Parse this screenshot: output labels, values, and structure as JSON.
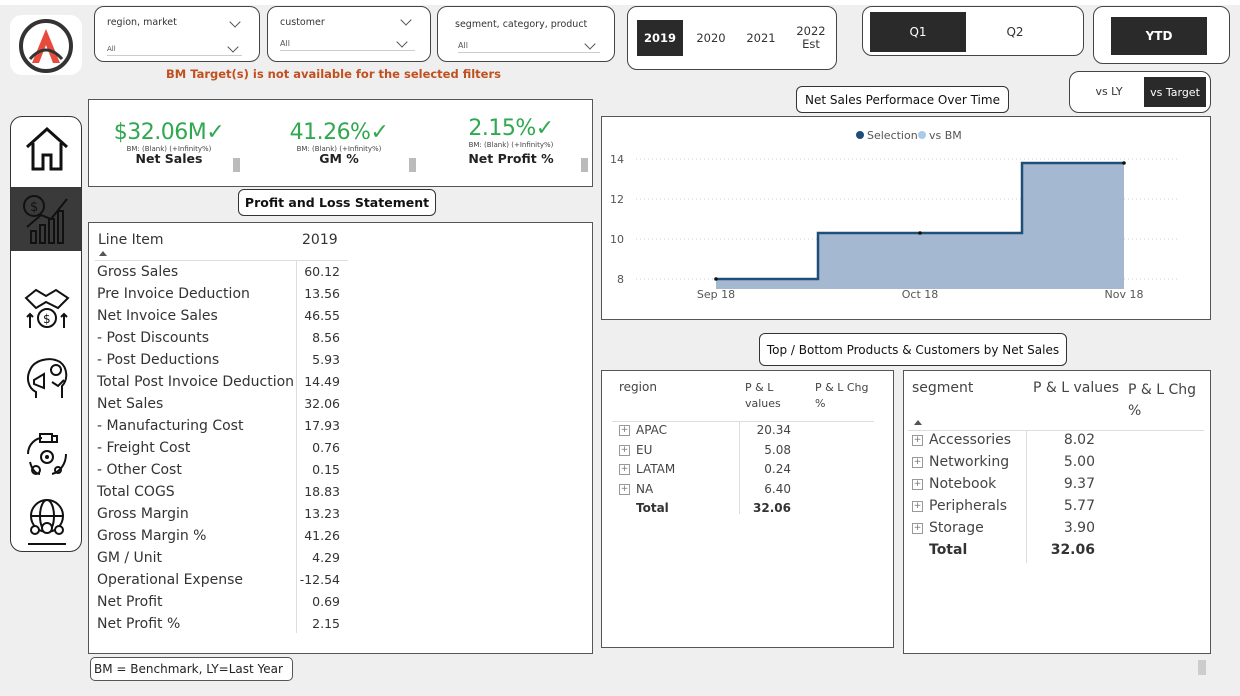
{
  "filters": {
    "region": {
      "title": "region, market",
      "value": "All"
    },
    "customer": {
      "title": "customer",
      "value": "All"
    },
    "segment": {
      "title": "segment, category, product",
      "value": "All"
    }
  },
  "years": [
    {
      "label": "2019",
      "selected": true
    },
    {
      "label": "2020",
      "selected": false
    },
    {
      "label": "2021",
      "selected": false
    },
    {
      "label": "2022\nEst",
      "selected": false
    }
  ],
  "quarters": [
    {
      "label": "Q1",
      "selected": true
    },
    {
      "label": "Q2",
      "selected": false
    }
  ],
  "ytd_label": "YTD",
  "warning": "BM Target(s) is not available for the selected filters",
  "compare": {
    "vs_ly": "vs LY",
    "vs_target": "vs Target"
  },
  "kpis": [
    {
      "value": "$32.06M✓",
      "bm": "BM: (Blank) (+Infinity%)",
      "label": "Net Sales"
    },
    {
      "value": "41.26%✓",
      "bm": "BM: (Blank) (+Infinity%)",
      "label": "GM %"
    },
    {
      "value": "2.15%✓",
      "bm": "BM: (Blank) (+Infinity%)",
      "label": "Net Profit %"
    }
  ],
  "pl": {
    "title": "Profit and Loss Statement",
    "col_item": "Line Item",
    "col_year": "2019",
    "rows": [
      {
        "label": "Gross Sales",
        "value": "60.12"
      },
      {
        "label": "Pre Invoice Deduction",
        "value": "13.56"
      },
      {
        "label": "Net Invoice Sales",
        "value": "46.55"
      },
      {
        "label": "- Post Discounts",
        "value": "8.56"
      },
      {
        "label": "- Post Deductions",
        "value": "5.93"
      },
      {
        "label": "Total Post Invoice Deduction",
        "value": "14.49"
      },
      {
        "label": "Net Sales",
        "value": "32.06"
      },
      {
        "label": "- Manufacturing Cost",
        "value": "17.93"
      },
      {
        "label": "- Freight Cost",
        "value": "0.76"
      },
      {
        "label": "- Other Cost",
        "value": "0.15"
      },
      {
        "label": "Total COGS",
        "value": "18.83"
      },
      {
        "label": "Gross Margin",
        "value": "13.23"
      },
      {
        "label": "Gross Margin %",
        "value": "41.26"
      },
      {
        "label": "GM / Unit",
        "value": "4.29"
      },
      {
        "label": "Operational Expense",
        "value": "-12.54"
      },
      {
        "label": "Net Profit",
        "value": "0.69"
      },
      {
        "label": "Net Profit %",
        "value": "2.15"
      }
    ]
  },
  "chart_data": {
    "type": "area",
    "title": "Net Sales Performace Over Time",
    "legend": [
      {
        "name": "Selection",
        "color": "#1f4e79"
      },
      {
        "name": "vs BM",
        "color": "#a8cbea"
      }
    ],
    "x": [
      "Sep 18",
      "Oct 18",
      "Nov 18"
    ],
    "series": [
      {
        "name": "Selection",
        "values": [
          8.0,
          10.3,
          13.8
        ]
      }
    ],
    "yticks": [
      8,
      10,
      12,
      14
    ],
    "ylim": [
      7.5,
      14.5
    ],
    "step": true
  },
  "topbottom_title": "Top / Bottom Products & Customers by Net Sales",
  "region_table": {
    "headers": [
      "region",
      "P & L\nvalues",
      "P & L Chg\n%"
    ],
    "rows": [
      {
        "label": "APAC",
        "value": "20.34"
      },
      {
        "label": "EU",
        "value": "5.08"
      },
      {
        "label": "LATAM",
        "value": "0.24"
      },
      {
        "label": "NA",
        "value": "6.40"
      }
    ],
    "total": {
      "label": "Total",
      "value": "32.06"
    }
  },
  "segment_table": {
    "headers": [
      "segment",
      "P & L values",
      "P & L Chg\n%"
    ],
    "rows": [
      {
        "label": "Accessories",
        "value": "8.02"
      },
      {
        "label": "Networking",
        "value": "5.00"
      },
      {
        "label": "Notebook",
        "value": "9.37"
      },
      {
        "label": "Peripherals",
        "value": "5.77"
      },
      {
        "label": "Storage",
        "value": "3.90"
      }
    ],
    "total": {
      "label": "Total",
      "value": "32.06"
    }
  },
  "footnote": "BM = Benchmark, LY=Last Year",
  "colors": {
    "kpi_green": "#2fa84f",
    "warning": "#c0501f",
    "area_fill": "#9fb5cf",
    "line": "#1f4e79",
    "logo_red": "#e84a3b"
  }
}
